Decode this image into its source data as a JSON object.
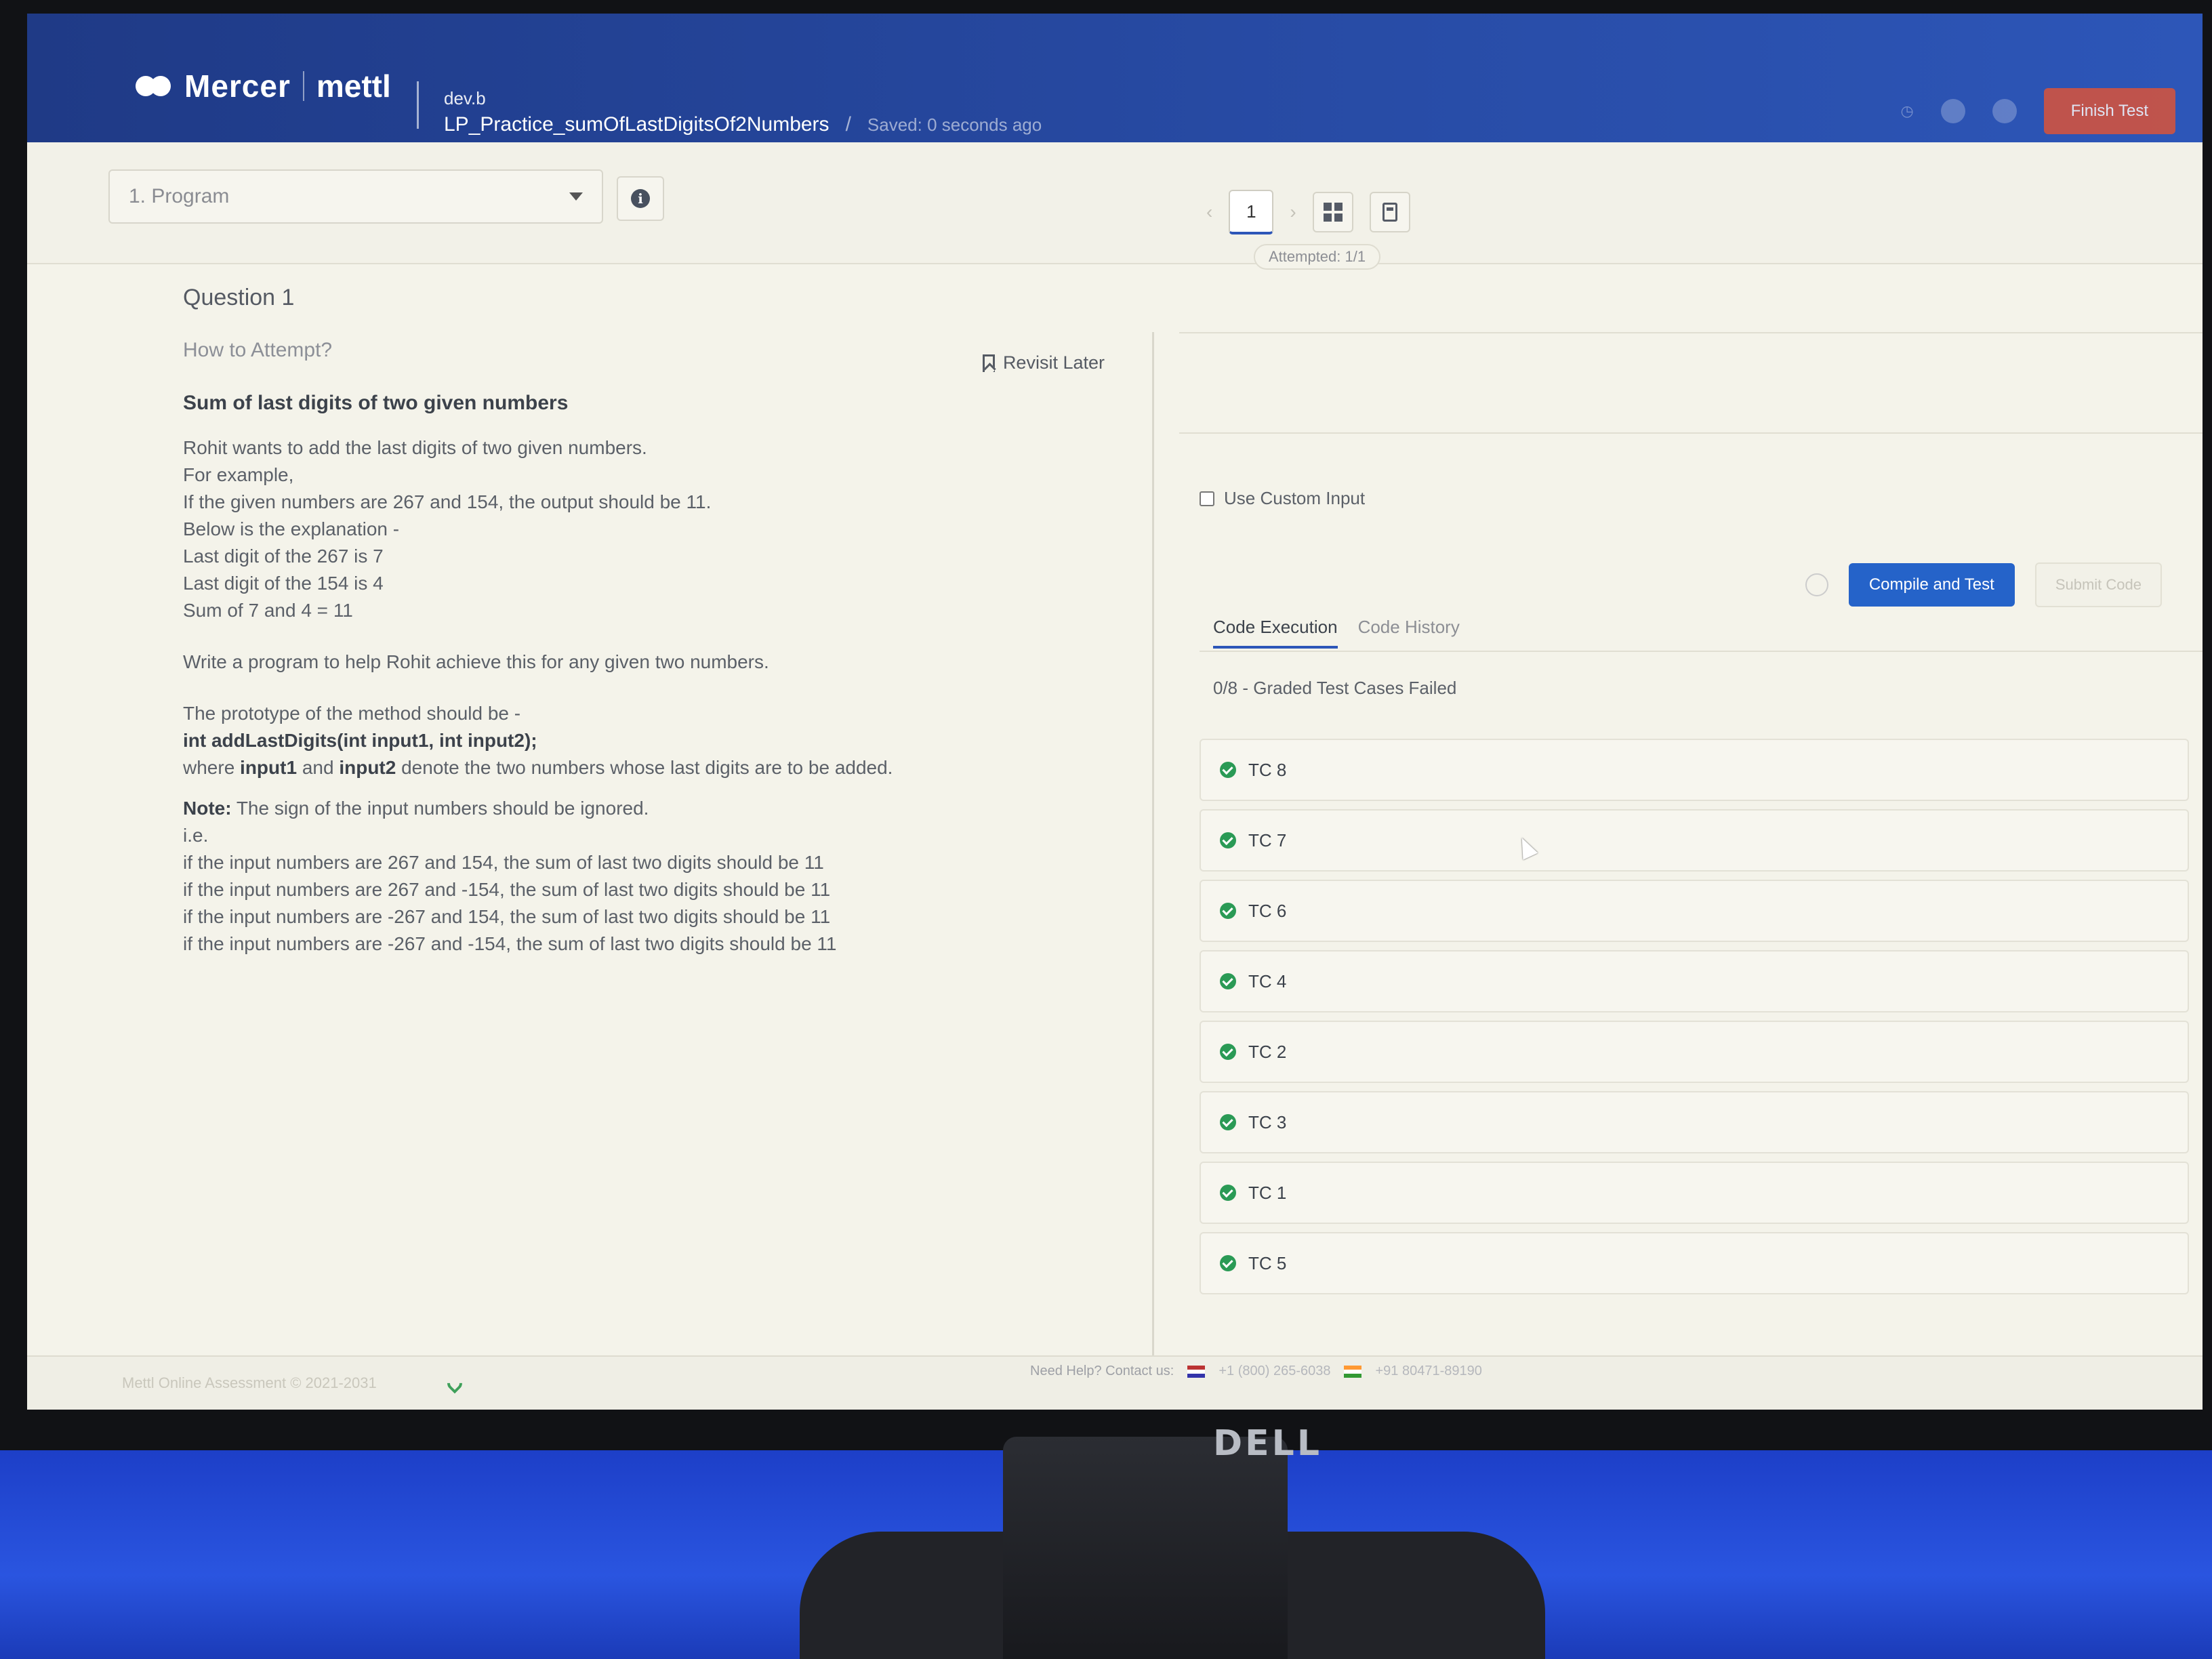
{
  "header": {
    "brand": "Mercer",
    "brand_sub": "mettl",
    "test_subtitle": "dev.b",
    "test_name": "LP_Practice_sumOfLastDigitsOf2Numbers",
    "separator": "/",
    "saved_status": "Saved: 0 seconds ago",
    "finish_label": "Finish Test"
  },
  "toolbar": {
    "section_label": "1. Program",
    "page_number": "1",
    "attempted": "Attempted: 1/1"
  },
  "question": {
    "title": "Question 1",
    "how_to": "How to Attempt?",
    "revisit_label": "Revisit Later",
    "problem_title": "Sum of last digits of two given numbers",
    "lines1": [
      "Rohit wants to add the last digits of two given numbers.",
      "For example,",
      "If the given numbers are 267 and 154, the output should be 11.",
      "Below is the explanation -",
      "Last digit of the 267 is 7",
      "Last digit of the 154 is 4",
      "Sum of 7 and 4 = 11"
    ],
    "write_line": "Write a program to help Rohit achieve this for any given two numbers.",
    "prototype_intro": "The prototype of the method should be -",
    "prototype": "int addLastDigits(int input1, int input2);",
    "where_prefix": "where",
    "input1": "input1",
    "and_word": "and",
    "input2": "input2",
    "where_suffix": "denote the two numbers whose last digits are to be added.",
    "note_label": "Note:",
    "note_text": "The sign of the input numbers should be ignored.",
    "ie": "i.e.",
    "examples": [
      "if the input numbers are 267 and 154, the sum of last two digits should be 11",
      "if the input numbers are 267 and -154, the sum of last two digits should be 11",
      "if the input numbers are -267 and 154, the sum of last two digits should be 11",
      "if the input numbers are -267 and -154, the sum of last two digits should be 11"
    ]
  },
  "editor": {
    "custom_input_label": "Use Custom Input",
    "compile_label": "Compile and Test",
    "submit_label": "Submit Code",
    "tabs": [
      "Code Execution",
      "Code History"
    ],
    "result": "0/8 - Graded Test Cases Failed",
    "test_cases": [
      "TC 8",
      "TC 7",
      "TC 6",
      "TC 4",
      "TC 2",
      "TC 3",
      "TC 1",
      "TC 5"
    ]
  },
  "footer": {
    "copyright": "Mettl Online Assessment © 2021-2031",
    "need_help": "Need Help? Contact us:",
    "phone_us": "+1 (800) 265-6038",
    "phone_in": "+91 80471-89190"
  },
  "monitor_brand": "DELL",
  "colors": {
    "header": "#274aa3",
    "accent": "#2563c9",
    "success": "#2a9a55",
    "finish": "#d9533a"
  }
}
